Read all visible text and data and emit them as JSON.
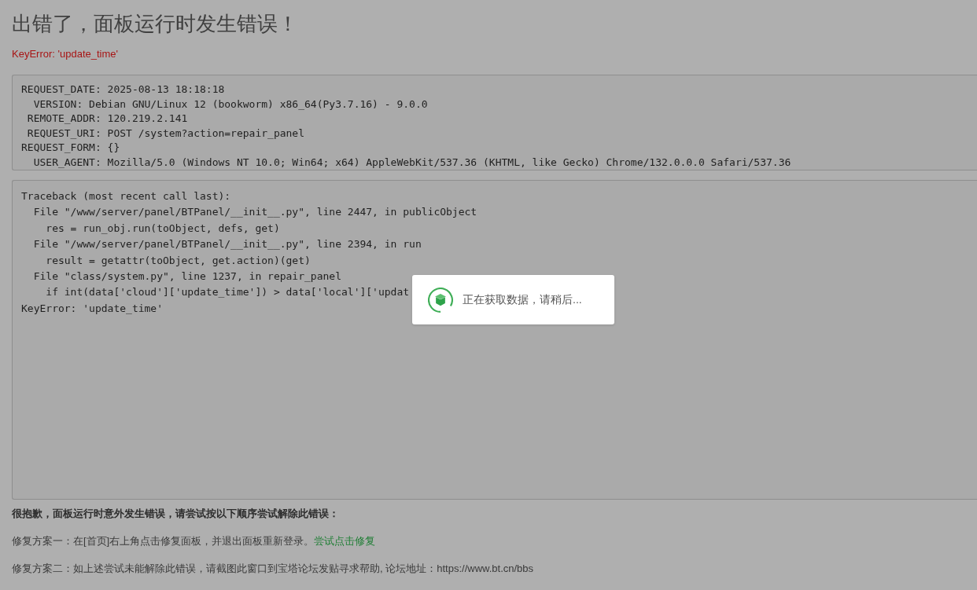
{
  "title": "出错了，面板运行时发生错误！",
  "error_message": "KeyError: 'update_time'",
  "request_info": {
    "lines": [
      "REQUEST_DATE: 2025-08-13 18:18:18",
      "  VERSION: Debian GNU/Linux 12 (bookworm) x86_64(Py3.7.16) - 9.0.0",
      " REMOTE_ADDR: 120.219.2.141",
      " REQUEST_URI: POST /system?action=repair_panel",
      "REQUEST_FORM: {}",
      "  USER_AGENT: Mozilla/5.0 (Windows NT 10.0; Win64; x64) AppleWebKit/537.36 (KHTML, like Gecko) Chrome/132.0.0.0 Safari/537.36"
    ]
  },
  "traceback": {
    "lines": [
      "Traceback (most recent call last):",
      "  File \"/www/server/panel/BTPanel/__init__.py\", line 2447, in publicObject",
      "    res = run_obj.run(toObject, defs, get)",
      "  File \"/www/server/panel/BTPanel/__init__.py\", line 2394, in run",
      "    result = getattr(toObject, get.action)(get)",
      "  File \"class/system.py\", line 1237, in repair_panel",
      "    if int(data['cloud']['update_time']) > data['local']['updat",
      "KeyError: 'update_time'"
    ]
  },
  "help": {
    "heading": "很抱歉，面板运行时意外发生错误，请尝试按以下顺序尝试解除此错误：",
    "solutions": [
      {
        "text": "修复方案一：在[首页]右上角点击修复面板，并退出面板重新登录。",
        "link": "尝试点击修复"
      },
      {
        "text": "修复方案二：如上述尝试未能解除此错误，请截图此窗口到宝塔论坛发贴寻求帮助, 论坛地址：https://www.bt.cn/bbs"
      }
    ]
  },
  "loading_dialog": {
    "message": "正在获取数据，请稍后..."
  }
}
